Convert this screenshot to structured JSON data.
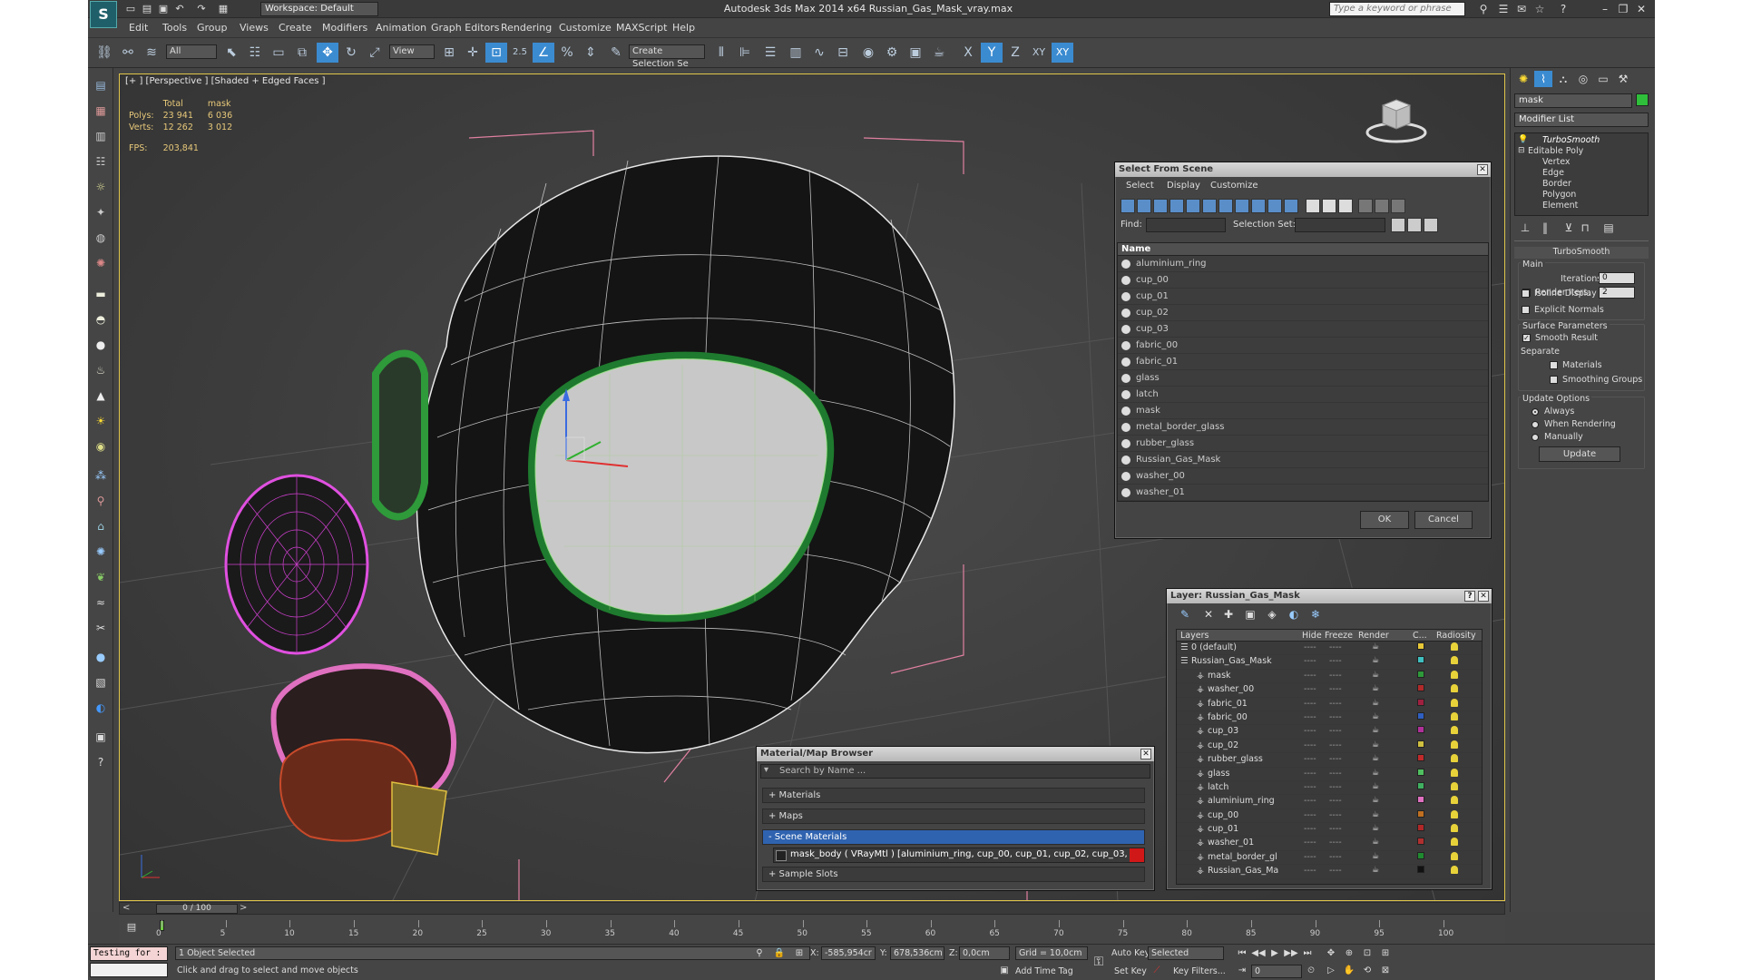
{
  "titlebar": {
    "workspace": "Workspace: Default",
    "title": "Autodesk 3ds Max  2014 x64     Russian_Gas_Mask_vray.max",
    "search_placeholder": "Type a keyword or phrase"
  },
  "menubar": [
    "Edit",
    "Tools",
    "Group",
    "Views",
    "Create",
    "Modifiers",
    "Animation",
    "Graph Editors",
    "Rendering",
    "Customize",
    "MAXScript",
    "Help"
  ],
  "toolbar": {
    "selection_filter": "All",
    "ref_coord": "View",
    "snap_value": "2.5",
    "named_selection": "Create Selection Se",
    "axis_x": "X",
    "axis_y": "Y",
    "axis_z": "Z",
    "axis_xy": "XY",
    "axis_xy2": "XY"
  },
  "viewport": {
    "label": "[+ ] [Perspective ] [Shaded + Edged Faces ]",
    "stats": {
      "col_total": "Total",
      "col_mask": "mask",
      "polys_label": "Polys:",
      "polys_total": "23 941",
      "polys_mask": "6 036",
      "verts_label": "Verts:",
      "verts_total": "12 262",
      "verts_mask": "3 012",
      "fps_label": "FPS:",
      "fps_value": "203,841"
    }
  },
  "select_from_scene": {
    "title": "Select From Scene",
    "menus": [
      "Select",
      "Display",
      "Customize"
    ],
    "find_label": "Find:",
    "selection_set_label": "Selection Set:",
    "column_name": "Name",
    "items": [
      "aluminium_ring",
      "cup_00",
      "cup_01",
      "cup_02",
      "cup_03",
      "fabric_00",
      "fabric_01",
      "glass",
      "latch",
      "mask",
      "metal_border_glass",
      "rubber_glass",
      "Russian_Gas_Mask",
      "washer_00",
      "washer_01"
    ],
    "ok": "OK",
    "cancel": "Cancel"
  },
  "layer_dialog": {
    "title": "Layer: Russian_Gas_Mask",
    "help": "?",
    "headers": {
      "layers": "Layers",
      "hide": "Hide",
      "freeze": "Freeze",
      "render": "Render",
      "color": "C...",
      "radiosity": "Radiosity"
    },
    "rows": [
      {
        "name": "0 (default)",
        "color": "#e8c838"
      },
      {
        "name": "Russian_Gas_Mask",
        "color": "#3fbfc0"
      },
      {
        "name": "mask",
        "color": "#2e9a3a"
      },
      {
        "name": "washer_00",
        "color": "#b02a2a"
      },
      {
        "name": "fabric_01",
        "color": "#a02040"
      },
      {
        "name": "fabric_00",
        "color": "#2f5fc0"
      },
      {
        "name": "cup_03",
        "color": "#b0309a"
      },
      {
        "name": "cup_02",
        "color": "#d0c040"
      },
      {
        "name": "rubber_glass",
        "color": "#c02a2a"
      },
      {
        "name": "glass",
        "color": "#50c060"
      },
      {
        "name": "latch",
        "color": "#40b060"
      },
      {
        "name": "aluminium_ring",
        "color": "#e070c0"
      },
      {
        "name": "cup_00",
        "color": "#c07020"
      },
      {
        "name": "cup_01",
        "color": "#b02828"
      },
      {
        "name": "washer_01",
        "color": "#b03030"
      },
      {
        "name": "metal_border_gl",
        "color": "#208a30"
      },
      {
        "name": "Russian_Gas_Ma",
        "color": "#111111"
      }
    ]
  },
  "material_browser": {
    "title": "Material/Map Browser",
    "search_placeholder": "Search by Name ...",
    "sections": [
      "+ Materials",
      "+ Maps",
      "- Scene Materials",
      "+ Sample Slots"
    ],
    "scene_material": "mask_body  ( VRayMtl )  [aluminium_ring, cup_00, cup_01, cup_02, cup_03, fabric..."
  },
  "command_panel": {
    "object_name": "mask",
    "modifier_list": "Modifier List",
    "stack": [
      "TurboSmooth",
      "Editable Poly",
      "Vertex",
      "Edge",
      "Border",
      "Polygon",
      "Element"
    ],
    "rollout_title": "TurboSmooth",
    "main_label": "Main",
    "iterations_label": "Iterations:",
    "iterations_value": "0",
    "render_iters_label": "Render Iters:",
    "render_iters_value": "2",
    "isoline": "Isoline Display",
    "explicit_normals": "Explicit Normals",
    "surface_params": "Surface Parameters",
    "smooth_result": "Smooth Result",
    "separate": "Separate",
    "materials": "Materials",
    "smoothing_groups": "Smoothing Groups",
    "update_options": "Update Options",
    "always": "Always",
    "when_rendering": "When Rendering",
    "manually": "Manually",
    "update_button": "Update"
  },
  "timeline": {
    "slider": "0 / 100",
    "ticks": [
      "0",
      "5",
      "10",
      "15",
      "20",
      "25",
      "30",
      "35",
      "40",
      "45",
      "50",
      "55",
      "60",
      "65",
      "70",
      "75",
      "80",
      "85",
      "90",
      "95",
      "100"
    ]
  },
  "status": {
    "maxscript": "Testing for :",
    "selected": "1 Object Selected",
    "prompt": "Click and drag to select and move objects",
    "x_label": "X:",
    "x_value": "-585,954cr",
    "y_label": "Y:",
    "y_value": "678,536cm",
    "z_label": "Z:",
    "z_value": "0,0cm",
    "grid": "Grid = 10,0cm",
    "add_time_tag": "Add Time Tag",
    "auto_key": "Auto Key",
    "set_key": "Set Key",
    "key_mode": "Selected",
    "key_filters": "Key Filters...",
    "frame": "0"
  }
}
